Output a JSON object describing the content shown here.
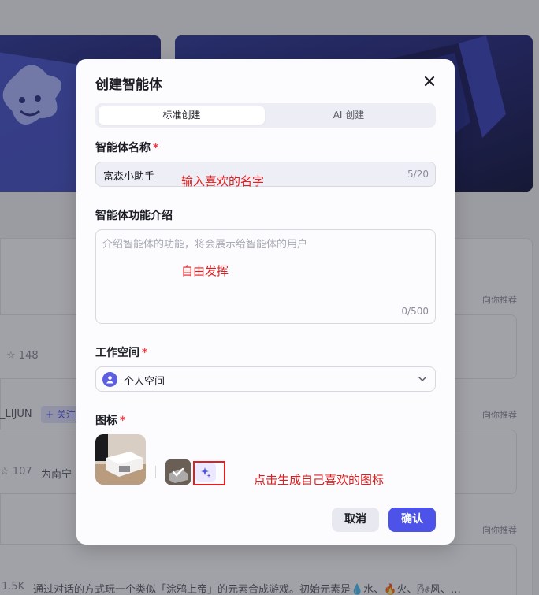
{
  "background": {
    "recommend_label": "向你推荐",
    "stat_1": "148",
    "user_name": "_LIJUN",
    "follow_label": "+ 关注",
    "stat_2": "107",
    "row2_text": "为南宁",
    "stat_3": "1.5K",
    "row3_text": "通过对话的方式玩一个类似「涂鸦上帝」的元素合成游戏。初始元素是💧水、🔥火、🌬风、…"
  },
  "modal": {
    "title": "创建智能体",
    "tabs": [
      {
        "label": "标准创建",
        "active": true
      },
      {
        "label": "AI 创建",
        "active": false
      }
    ],
    "name_field": {
      "label": "智能体名称",
      "value": "富森小助手",
      "counter": "5/20"
    },
    "description_field": {
      "label": "智能体功能介绍",
      "placeholder": "介绍智能体的功能，将会展示给智能体的用户",
      "counter": "0/500"
    },
    "workspace_field": {
      "label": "工作空间",
      "value": "个人空间"
    },
    "icon_field": {
      "label": "图标"
    },
    "cancel_label": "取消",
    "confirm_label": "确认"
  },
  "annotations": {
    "name_hint": "输入喜欢的名字",
    "desc_hint": "自由发挥",
    "icon_hint": "点击生成自己喜欢的图标"
  },
  "colors": {
    "accent": "#4d53e8",
    "required": "#f0373e",
    "annotation": "#e02020"
  }
}
